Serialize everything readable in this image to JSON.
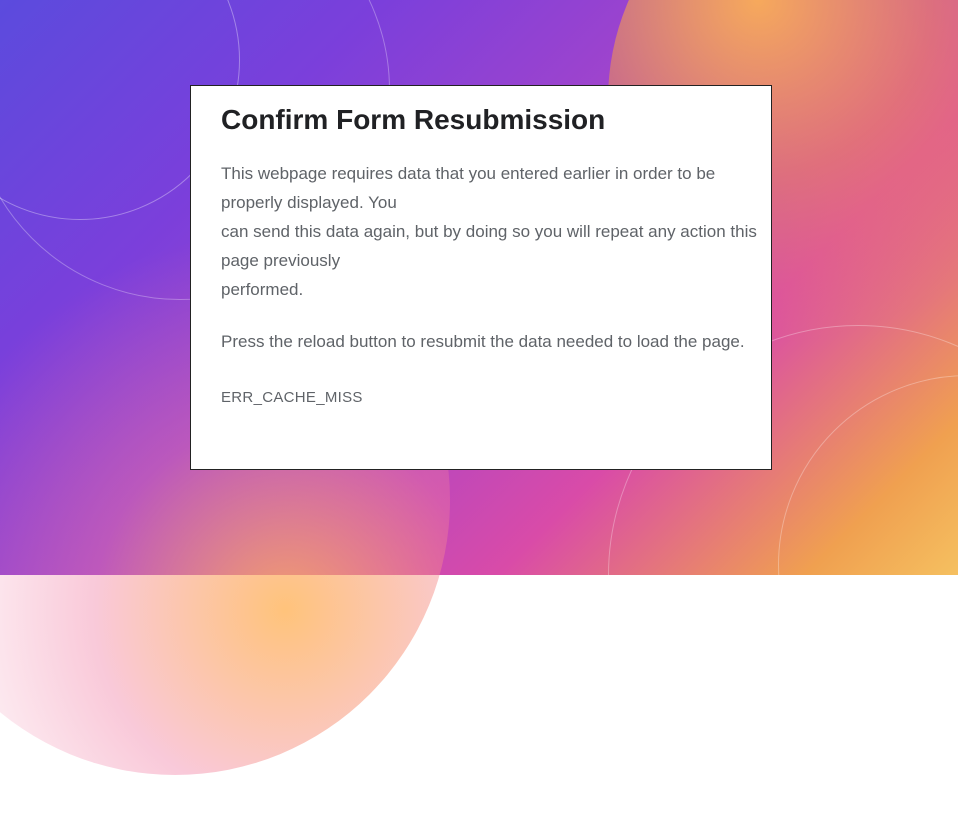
{
  "error": {
    "title": "Confirm Form Resubmission",
    "message": "This webpage requires data that you entered earlier in order to be properly displayed. You\ncan send this data again, but by doing so you will repeat any action this page previously\nperformed.",
    "instruction": "Press the reload button to resubmit the data needed to load the page.",
    "code": "ERR_CACHE_MISS"
  }
}
